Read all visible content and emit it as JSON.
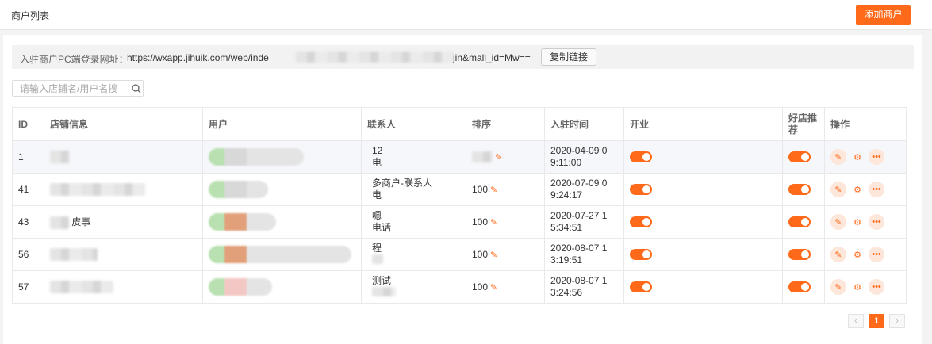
{
  "header": {
    "title": "商户列表",
    "add_button": "添加商户"
  },
  "login_url": {
    "label": "入驻商户PC端登录网址：",
    "prefix": "https://wxapp.jihuik.com/web/inde",
    "suffix": "jin&mall_id=Mw==",
    "copy_button": "复制链接"
  },
  "search": {
    "placeholder": "请输入店铺名/用户名搜"
  },
  "table": {
    "headers": [
      "ID",
      "店铺信息",
      "用户",
      "联系人",
      "排序",
      "入驻时间",
      "开业",
      "好店推荐",
      "操作"
    ],
    "rows": [
      {
        "id": "1",
        "contact_line1": "12",
        "contact_line2": "电",
        "sort": "",
        "time_line1": "2020-04-09 0",
        "time_line2": "9:11:00"
      },
      {
        "id": "41",
        "contact_line1": "多商户-联系人",
        "contact_line2": "电",
        "sort": "100",
        "time_line1": "2020-07-09 0",
        "time_line2": "9:24:17"
      },
      {
        "id": "43",
        "shop": "皮事",
        "contact_line1": "嗯",
        "contact_line2": "电话",
        "sort": "100",
        "time_line1": "2020-07-27 1",
        "time_line2": "5:34:51"
      },
      {
        "id": "56",
        "contact_line1": "程",
        "contact_line2": "",
        "sort": "100",
        "time_line1": "2020-08-07 1",
        "time_line2": "3:19:51"
      },
      {
        "id": "57",
        "contact_line1": "测试",
        "contact_line2": "",
        "sort": "100",
        "time_line1": "2020-08-07 1",
        "time_line2": "3:24:56"
      }
    ]
  },
  "pagination": {
    "prev": "‹",
    "current": "1",
    "next": "›"
  },
  "colors": {
    "accent": "#ff6a1a",
    "accent_light": "#fde6da"
  },
  "icons": [
    "search-icon",
    "pencil-icon",
    "gear-icon",
    "more-icon"
  ]
}
